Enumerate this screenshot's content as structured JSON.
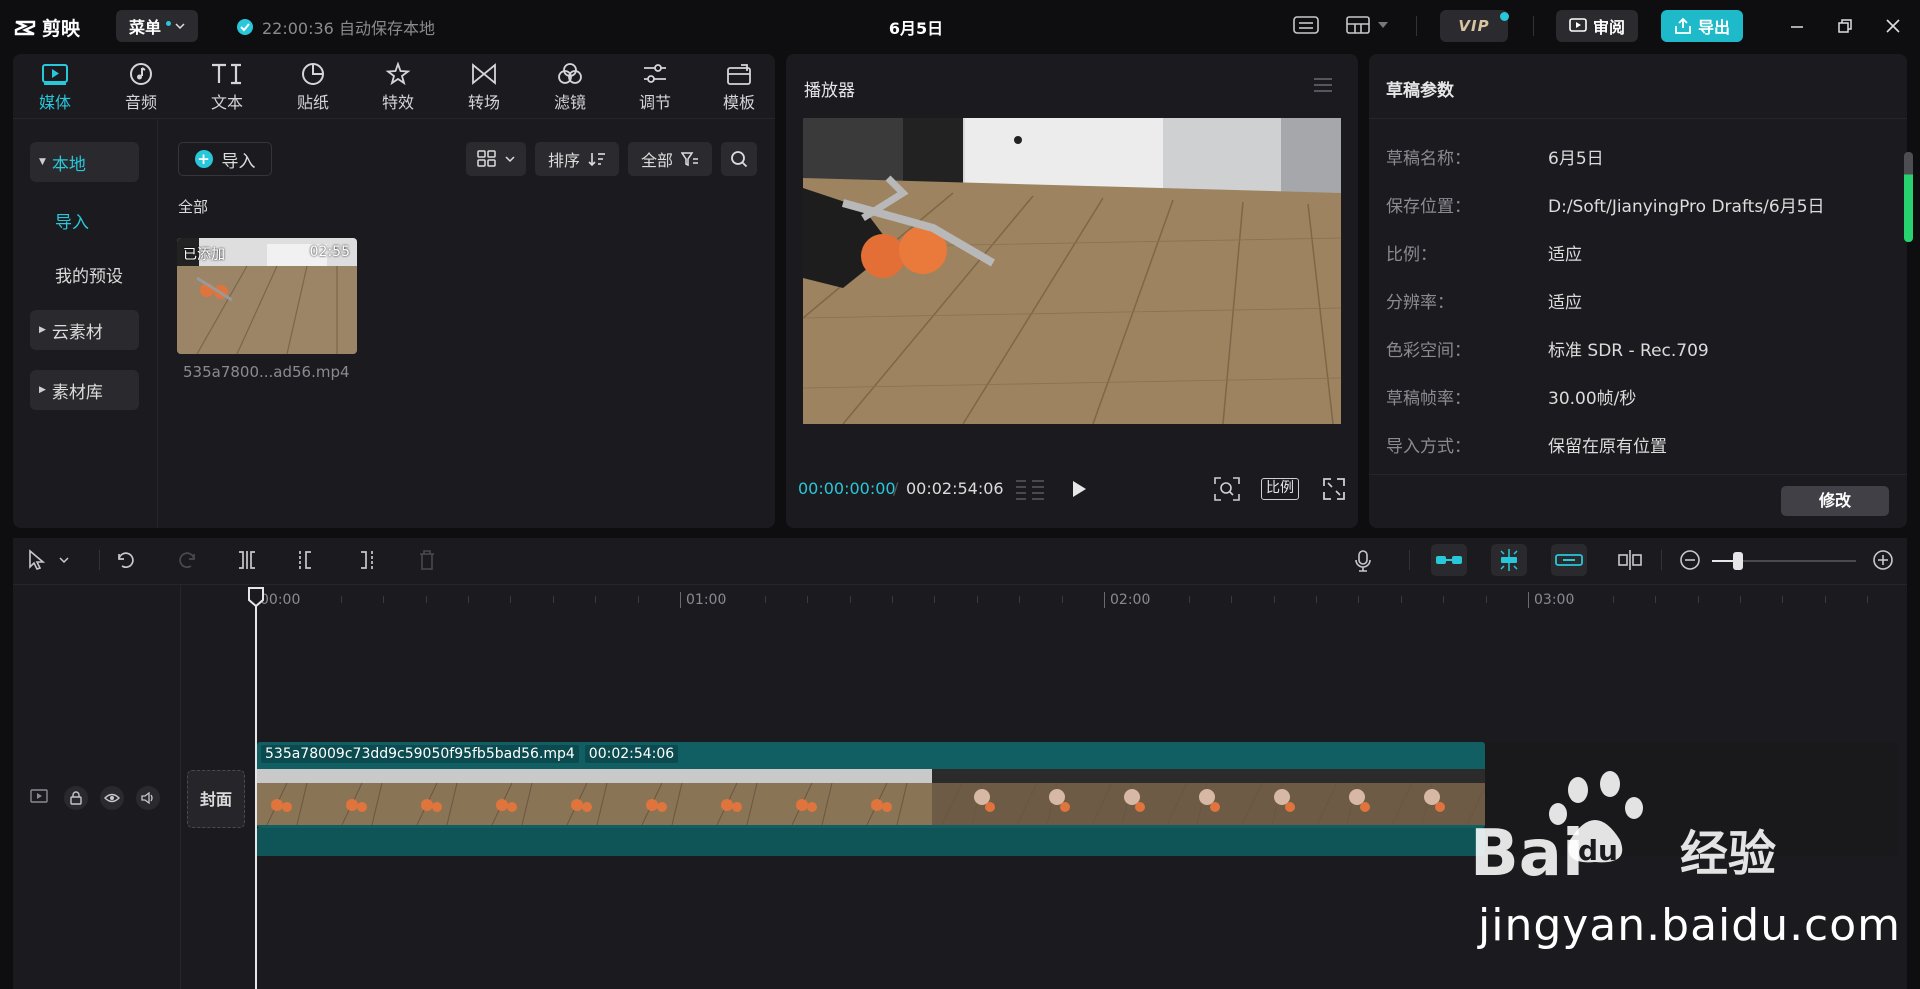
{
  "titlebar": {
    "app_name": "剪映",
    "menu_label": "菜单",
    "autosave_text": "22:00:36 自动保存本地",
    "doc_title": "6月5日",
    "vip_label": "VIP",
    "review_label": "审阅",
    "export_label": "导出"
  },
  "media": {
    "tabs": [
      {
        "label": "媒体",
        "icon": "media-icon"
      },
      {
        "label": "音频",
        "icon": "audio-icon"
      },
      {
        "label": "文本",
        "icon": "text-icon"
      },
      {
        "label": "贴纸",
        "icon": "sticker-icon"
      },
      {
        "label": "特效",
        "icon": "effects-icon"
      },
      {
        "label": "转场",
        "icon": "transition-icon"
      },
      {
        "label": "滤镜",
        "icon": "filter-icon"
      },
      {
        "label": "调节",
        "icon": "adjust-icon"
      },
      {
        "label": "模板",
        "icon": "template-icon"
      }
    ],
    "sidebar": {
      "local": "本地",
      "import": "导入",
      "presets": "我的预设",
      "cloud": "云素材",
      "library": "素材库"
    },
    "import_button": "导入",
    "sort_label": "排序",
    "filter_label": "全部",
    "section_label": "全部",
    "item": {
      "added_badge": "已添加",
      "duration": "02:55",
      "filename": "535a7800...ad56.mp4"
    }
  },
  "player": {
    "title": "播放器",
    "current_time": "00:00:00:00",
    "separator": "/",
    "total_time": "00:02:54:06",
    "ratio_label": "比例"
  },
  "draft": {
    "title": "草稿参数",
    "fields": [
      {
        "key": "草稿名称：",
        "value": "6月5日"
      },
      {
        "key": "保存位置：",
        "value": "D:/Soft/JianyingPro Drafts/6月5日"
      },
      {
        "key": "比例：",
        "value": "适应"
      },
      {
        "key": "分辨率：",
        "value": "适应"
      },
      {
        "key": "色彩空间：",
        "value": "标准 SDR - Rec.709"
      },
      {
        "key": "草稿帧率：",
        "value": "30.00帧/秒"
      },
      {
        "key": "导入方式：",
        "value": "保留在原有位置"
      }
    ],
    "modify_button": "修改"
  },
  "timeline": {
    "ruler": [
      "00:00",
      "01:00",
      "02:00",
      "03:00"
    ],
    "cover_label": "封面",
    "clip_name": "535a78009c73dd9c59050f95fb5bad56.mp4",
    "clip_duration": "00:02:54:06"
  },
  "watermark": {
    "text": "jingyan.baidu.com",
    "logo_text": "Bai du 经验"
  },
  "colors": {
    "accent": "#28c7d9",
    "export": "#1fbac9",
    "clip": "#125f63",
    "panel": "#1b1b1f"
  }
}
